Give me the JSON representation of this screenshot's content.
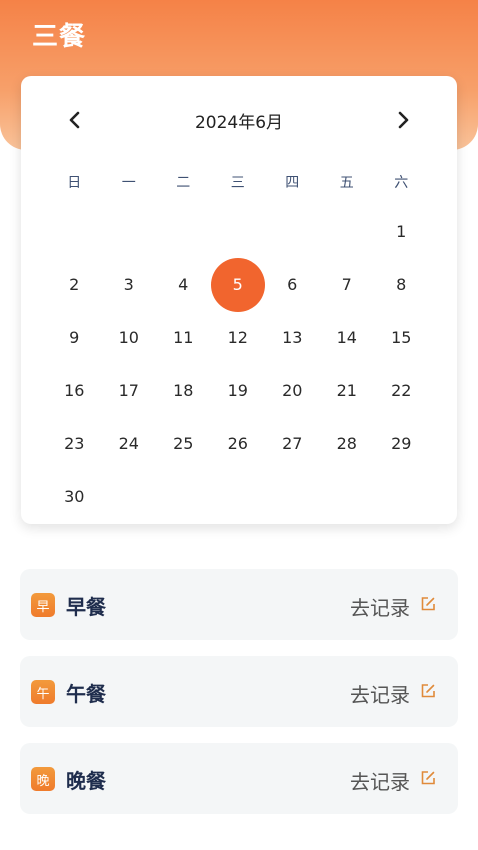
{
  "app": {
    "title": "三餐"
  },
  "calendar": {
    "month_label": "2024年6月",
    "prev_icon": "chevron-left-icon",
    "next_icon": "chevron-right-icon",
    "weekdays": [
      "日",
      "一",
      "二",
      "三",
      "四",
      "五",
      "六"
    ],
    "selected_day": "5",
    "weeks": [
      [
        "",
        "",
        "",
        "",
        "",
        "",
        "1"
      ],
      [
        "2",
        "3",
        "4",
        "5",
        "6",
        "7",
        "8"
      ],
      [
        "9",
        "10",
        "11",
        "12",
        "13",
        "14",
        "15"
      ],
      [
        "16",
        "17",
        "18",
        "19",
        "20",
        "21",
        "22"
      ],
      [
        "23",
        "24",
        "25",
        "26",
        "27",
        "28",
        "29"
      ],
      [
        "30",
        "",
        "",
        "",
        "",
        "",
        ""
      ]
    ],
    "accent_color": "#f1652e"
  },
  "meals": [
    {
      "badge": "早",
      "name": "早餐",
      "action": "去记录",
      "icon": "edit-icon"
    },
    {
      "badge": "午",
      "name": "午餐",
      "action": "去记录",
      "icon": "edit-icon"
    },
    {
      "badge": "晚",
      "name": "晚餐",
      "action": "去记录",
      "icon": "edit-icon"
    }
  ]
}
